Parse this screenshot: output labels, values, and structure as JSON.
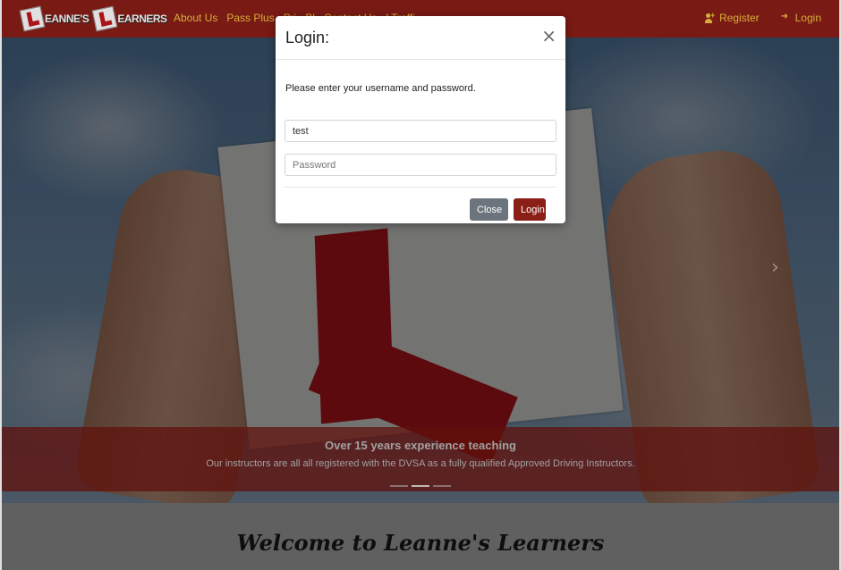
{
  "brand": {
    "word1": "EANNE'S",
    "word2": "EARNERS"
  },
  "nav": {
    "links": [
      "About Us",
      "Pass Plus",
      "Pri",
      "Bl",
      "Contact Us",
      "l Traffi"
    ],
    "register": "Register",
    "login": "Login"
  },
  "carousel": {
    "title": "Over 15 years experience teaching",
    "text": "Our instructors are all all registered with the DVSA as a fully qualified Approved Driving Instructors.",
    "next_icon": "chevron-right-icon",
    "slides": 3,
    "active_slide": 2
  },
  "welcome": {
    "title": "Welcome to Leanne's Learners"
  },
  "modal": {
    "title": "Login:",
    "close_glyph": "×",
    "prompt": "Please enter your username and password.",
    "username_value": "test",
    "password_placeholder": "Password",
    "close_label": "Close",
    "login_label": "Login"
  },
  "colors": {
    "navbar": "#8b1e17",
    "nav_link": "#f4c542",
    "login_button": "#8b1e17",
    "close_button": "#6c757d"
  }
}
